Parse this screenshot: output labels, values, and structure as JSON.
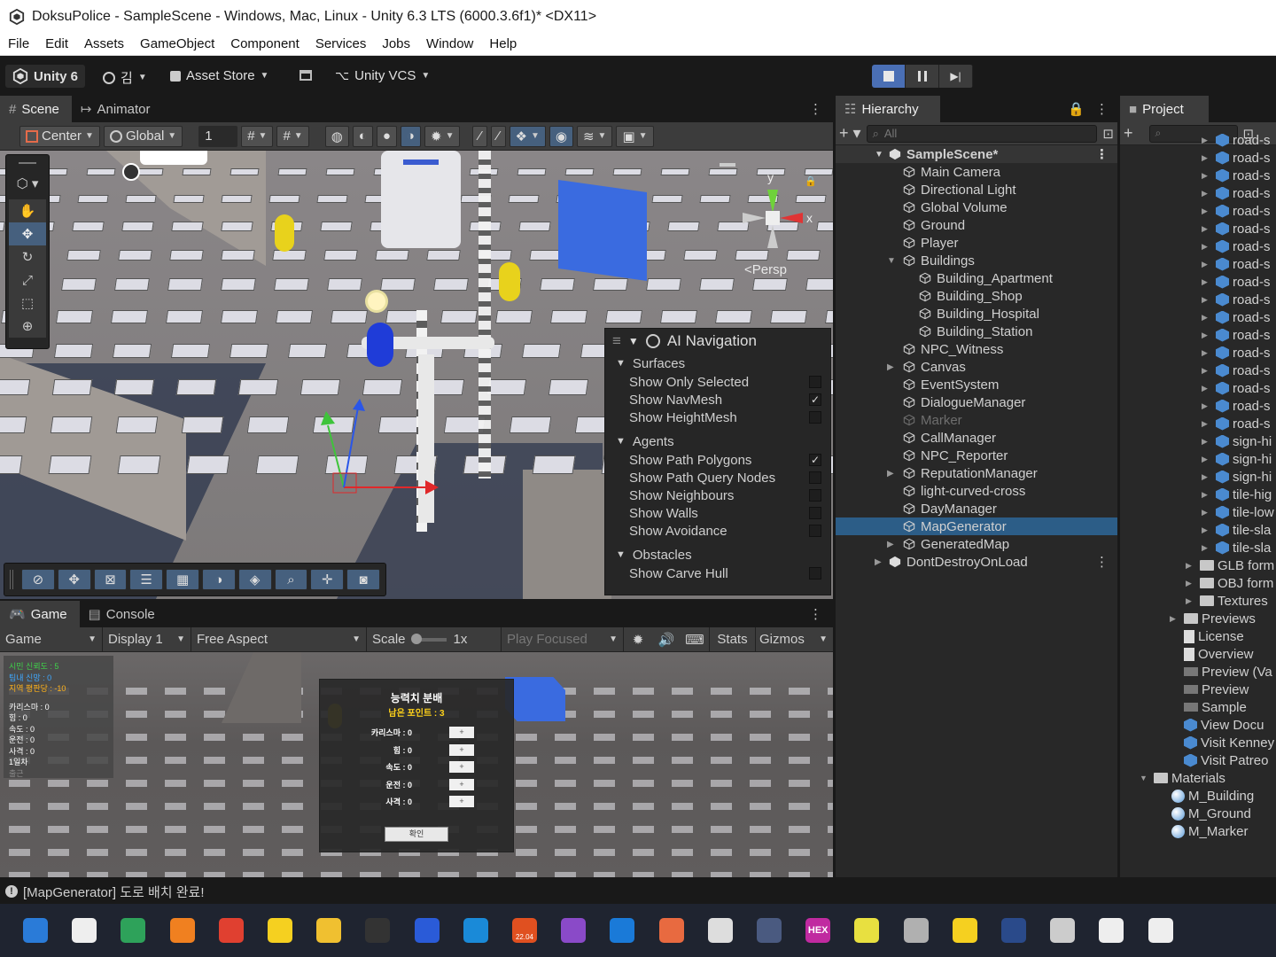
{
  "window": {
    "title": "DoksuPolice - SampleScene - Windows, Mac, Linux - Unity 6.3 LTS (6000.3.6f1)* <DX11>"
  },
  "menu": [
    "File",
    "Edit",
    "Assets",
    "GameObject",
    "Component",
    "Services",
    "Jobs",
    "Window",
    "Help"
  ],
  "toolbar": {
    "unity_label": "Unity 6",
    "account": "김",
    "asset_store": "Asset Store",
    "vcs": "Unity VCS"
  },
  "scene_tabs": {
    "scene": "Scene",
    "animator": "Animator"
  },
  "scene_toolbar": {
    "pivot": "Center",
    "space": "Global",
    "snap_value": "1"
  },
  "scene": {
    "persp_label": "<Persp",
    "gizmo_y": "y",
    "gizmo_x": "x"
  },
  "ai_navigation": {
    "title": "AI Navigation",
    "surfaces": "Surfaces",
    "surface_items": [
      {
        "label": "Show Only Selected",
        "checked": false
      },
      {
        "label": "Show NavMesh",
        "checked": true
      },
      {
        "label": "Show HeightMesh",
        "checked": false
      }
    ],
    "agents": "Agents",
    "agent_items": [
      {
        "label": "Show Path Polygons",
        "checked": true
      },
      {
        "label": "Show Path Query Nodes",
        "checked": false
      },
      {
        "label": "Show Neighbours",
        "checked": false
      },
      {
        "label": "Show Walls",
        "checked": false
      },
      {
        "label": "Show Avoidance",
        "checked": false
      }
    ],
    "obstacles": "Obstacles",
    "obstacle_items": [
      {
        "label": "Show Carve Hull",
        "checked": false
      }
    ]
  },
  "game_tabs": {
    "game": "Game",
    "console": "Console"
  },
  "game_toolbar": {
    "mode": "Game",
    "display": "Display 1",
    "aspect": "Free Aspect",
    "scale_label": "Scale",
    "scale_value": "1x",
    "play_focused": "Play Focused",
    "stats": "Stats",
    "gizmos": "Gizmos"
  },
  "game_hud": {
    "stats_colored": [
      {
        "text": "시민 신뢰도 : 5",
        "color": "#3fd24a"
      },
      {
        "text": "팀내 신망 : 0",
        "color": "#3fa8ff"
      },
      {
        "text": "지역 평판당 : -10",
        "color": "#ffb21a"
      }
    ],
    "stats": [
      "카리스마 : 0",
      "힘 : 0",
      "속도 : 0",
      "운전 : 0",
      "사격 : 0",
      "1일차",
      "출근"
    ],
    "dialog_title": "능력치 분배",
    "dialog_points": "남은 포인트 : 3",
    "dialog_rows": [
      {
        "label": "카리스마 : 0",
        "button": "+"
      },
      {
        "label": "힘 : 0",
        "button": "+"
      },
      {
        "label": "속도 : 0",
        "button": "+"
      },
      {
        "label": "운전 : 0",
        "button": "+"
      },
      {
        "label": "사격 : 0",
        "button": "+"
      }
    ],
    "dialog_confirm": "확인"
  },
  "hierarchy": {
    "tab": "Hierarchy",
    "search_placeholder": "All",
    "scene": "SampleScene*",
    "items": [
      {
        "label": "Main Camera",
        "depth": 1,
        "fold": ""
      },
      {
        "label": "Directional Light",
        "depth": 1,
        "fold": ""
      },
      {
        "label": "Global Volume",
        "depth": 1,
        "fold": ""
      },
      {
        "label": "Ground",
        "depth": 1,
        "fold": ""
      },
      {
        "label": "Player",
        "depth": 1,
        "fold": ""
      },
      {
        "label": "Buildings",
        "depth": 1,
        "fold": "open"
      },
      {
        "label": "Building_Apartment",
        "depth": 2,
        "fold": ""
      },
      {
        "label": "Building_Shop",
        "depth": 2,
        "fold": ""
      },
      {
        "label": "Building_Hospital",
        "depth": 2,
        "fold": ""
      },
      {
        "label": "Building_Station",
        "depth": 2,
        "fold": ""
      },
      {
        "label": "NPC_Witness",
        "depth": 1,
        "fold": ""
      },
      {
        "label": "Canvas",
        "depth": 1,
        "fold": "closed"
      },
      {
        "label": "EventSystem",
        "depth": 1,
        "fold": ""
      },
      {
        "label": "DialogueManager",
        "depth": 1,
        "fold": ""
      },
      {
        "label": "Marker",
        "depth": 1,
        "fold": "",
        "disabled": true
      },
      {
        "label": "CallManager",
        "depth": 1,
        "fold": ""
      },
      {
        "label": "NPC_Reporter",
        "depth": 1,
        "fold": ""
      },
      {
        "label": "ReputationManager",
        "depth": 1,
        "fold": "closed"
      },
      {
        "label": "light-curved-cross",
        "depth": 1,
        "fold": ""
      },
      {
        "label": "DayManager",
        "depth": 1,
        "fold": ""
      },
      {
        "label": "MapGenerator",
        "depth": 1,
        "fold": "",
        "selected": true
      },
      {
        "label": "GeneratedMap",
        "depth": 1,
        "fold": "closed"
      }
    ],
    "dontdestroy": "DontDestroyOnLoad"
  },
  "project": {
    "tab": "Project",
    "prefabs": [
      "road-s",
      "road-s",
      "road-s",
      "road-s",
      "road-s",
      "road-s",
      "road-s",
      "road-s",
      "road-s",
      "road-s",
      "road-s",
      "road-s",
      "road-s",
      "road-s",
      "road-s",
      "road-s",
      "road-s",
      "sign-hi",
      "sign-hi",
      "sign-hi",
      "tile-hig",
      "tile-low",
      "tile-sla",
      "tile-sla"
    ],
    "folders": [
      "GLB form",
      "OBJ form",
      "Textures"
    ],
    "root_items": [
      {
        "label": "Previews",
        "kind": "folder"
      },
      {
        "label": "License",
        "kind": "doc"
      },
      {
        "label": "Overview",
        "kind": "doc"
      },
      {
        "label": "Preview (Va",
        "kind": "image"
      },
      {
        "label": "Preview",
        "kind": "image"
      },
      {
        "label": "Sample",
        "kind": "image"
      },
      {
        "label": "View Docu",
        "kind": "link"
      },
      {
        "label": "Visit Kenney",
        "kind": "link"
      },
      {
        "label": "Visit Patreo",
        "kind": "link"
      }
    ],
    "materials_folder": "Materials",
    "materials": [
      "M_Building",
      "M_Ground",
      "M_Marker"
    ]
  },
  "status_bar": {
    "message": "[MapGenerator] 도로 배치 완료!"
  },
  "taskbar": [
    "start-icon",
    "search-icon",
    "app-green-icon",
    "magnifier-icon",
    "chrome-icon",
    "kakaotalk-icon",
    "explorer-icon",
    "terminal-icon",
    "word-icon",
    "app-icon",
    "ubuntu-icon",
    "visual-studio-icon",
    "vscode-icon",
    "claude-icon",
    "chatgpt-icon",
    "app-icon",
    "hex-icon",
    "app-icon",
    "database-icon",
    "sticky-notes-icon",
    "steam-icon",
    "task-view-icon",
    "unity-hub-icon",
    "unity-icon"
  ],
  "ubuntu_label": "22.04",
  "hex_label": "HEX"
}
